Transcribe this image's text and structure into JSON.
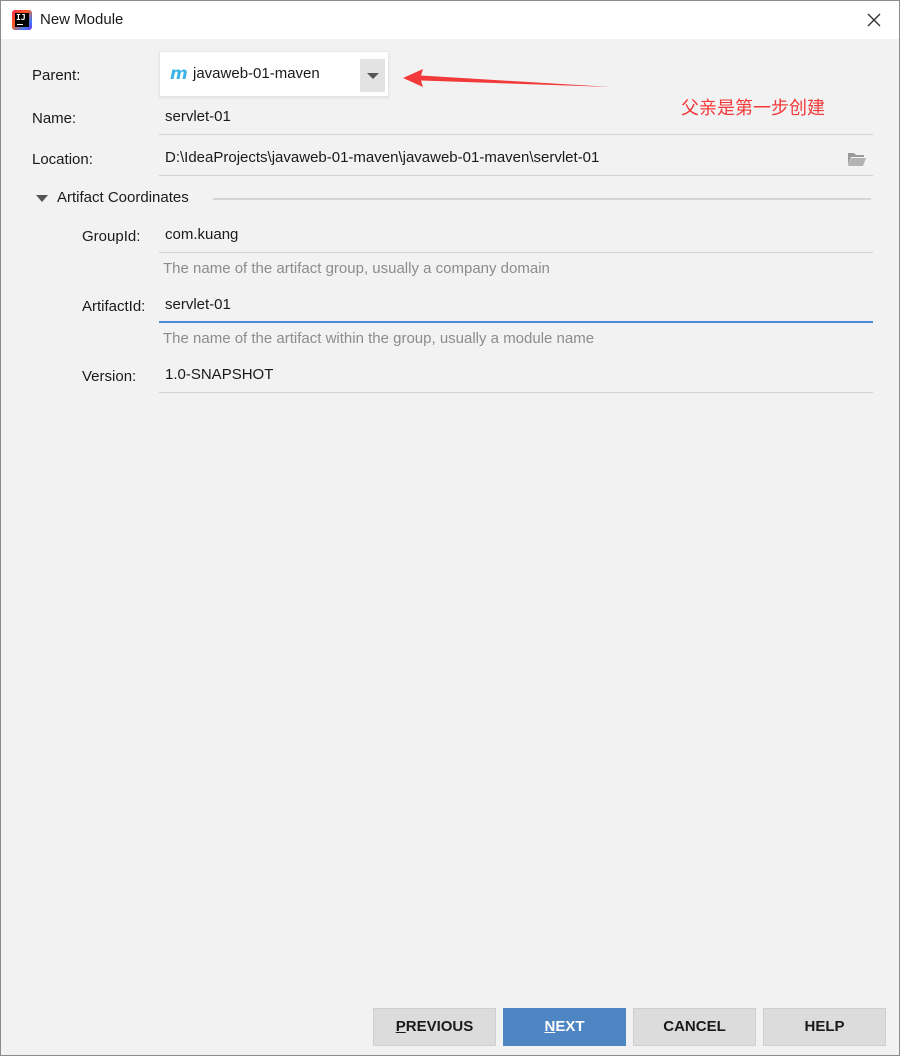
{
  "window": {
    "title": "New Module"
  },
  "form": {
    "parent_label": "Parent:",
    "parent_value": "javaweb-01-maven",
    "parent_icon": "m",
    "name_label": "Name:",
    "name_value": "servlet-01",
    "location_label": "Location:",
    "location_value": "D:\\IdeaProjects\\javaweb-01-maven\\javaweb-01-maven\\servlet-01"
  },
  "artifact": {
    "section_title": "Artifact Coordinates",
    "groupid_label": "GroupId:",
    "groupid_value": "com.kuang",
    "groupid_hint": "The name of the artifact group, usually a company domain",
    "artifactid_label": "ArtifactId:",
    "artifactid_value": "servlet-01",
    "artifactid_hint": "The name of the artifact within the group, usually a module name",
    "version_label": "Version:",
    "version_value": "1.0-SNAPSHOT"
  },
  "annotation": {
    "text": "父亲是第一步创建",
    "color": "#f23a3a"
  },
  "buttons": {
    "previous_mnemonic": "P",
    "previous_rest": "REVIOUS",
    "next_mnemonic": "N",
    "next_rest": "EXT",
    "cancel": "CANCEL",
    "help": "HELP"
  },
  "colors": {
    "accent": "#4a89dc",
    "primary_button": "#4d86c2",
    "maven_icon": "#3ab4e6"
  }
}
